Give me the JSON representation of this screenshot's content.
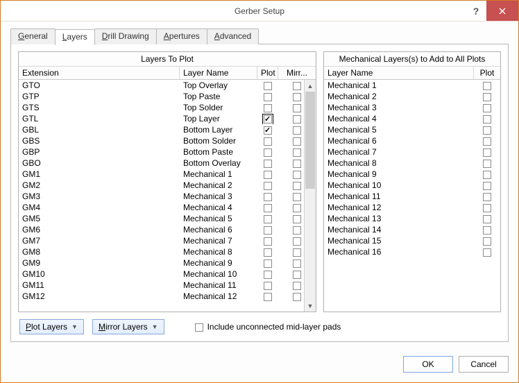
{
  "window": {
    "title": "Gerber Setup"
  },
  "tabs": [
    "General",
    "Layers",
    "Drill Drawing",
    "Apertures",
    "Advanced"
  ],
  "active_tab": 1,
  "left_panel": {
    "title": "Layers To Plot",
    "columns": {
      "ext": "Extension",
      "layer": "Layer Name",
      "plot": "Plot",
      "mirr": "Mirr..."
    },
    "rows": [
      {
        "ext": "GTO",
        "layer": "Top Overlay",
        "plot": false,
        "mirr": false
      },
      {
        "ext": "GTP",
        "layer": "Top Paste",
        "plot": false,
        "mirr": false
      },
      {
        "ext": "GTS",
        "layer": "Top Solder",
        "plot": false,
        "mirr": false
      },
      {
        "ext": "GTL",
        "layer": "Top Layer",
        "plot": true,
        "mirr": false,
        "focused": true
      },
      {
        "ext": "GBL",
        "layer": "Bottom Layer",
        "plot": true,
        "mirr": false
      },
      {
        "ext": "GBS",
        "layer": "Bottom Solder",
        "plot": false,
        "mirr": false
      },
      {
        "ext": "GBP",
        "layer": "Bottom Paste",
        "plot": false,
        "mirr": false
      },
      {
        "ext": "GBO",
        "layer": "Bottom Overlay",
        "plot": false,
        "mirr": false
      },
      {
        "ext": "GM1",
        "layer": "Mechanical 1",
        "plot": false,
        "mirr": false
      },
      {
        "ext": "GM2",
        "layer": "Mechanical 2",
        "plot": false,
        "mirr": false
      },
      {
        "ext": "GM3",
        "layer": "Mechanical 3",
        "plot": false,
        "mirr": false
      },
      {
        "ext": "GM4",
        "layer": "Mechanical 4",
        "plot": false,
        "mirr": false
      },
      {
        "ext": "GM5",
        "layer": "Mechanical 5",
        "plot": false,
        "mirr": false
      },
      {
        "ext": "GM6",
        "layer": "Mechanical 6",
        "plot": false,
        "mirr": false
      },
      {
        "ext": "GM7",
        "layer": "Mechanical 7",
        "plot": false,
        "mirr": false
      },
      {
        "ext": "GM8",
        "layer": "Mechanical 8",
        "plot": false,
        "mirr": false
      },
      {
        "ext": "GM9",
        "layer": "Mechanical 9",
        "plot": false,
        "mirr": false
      },
      {
        "ext": "GM10",
        "layer": "Mechanical 10",
        "plot": false,
        "mirr": false
      },
      {
        "ext": "GM11",
        "layer": "Mechanical 11",
        "plot": false,
        "mirr": false
      },
      {
        "ext": "GM12",
        "layer": "Mechanical 12",
        "plot": false,
        "mirr": false
      }
    ]
  },
  "right_panel": {
    "title": "Mechanical Layers(s) to Add to All Plots",
    "columns": {
      "layer": "Layer Name",
      "plot": "Plot"
    },
    "rows": [
      {
        "layer": "Mechanical 1",
        "plot": false
      },
      {
        "layer": "Mechanical 2",
        "plot": false
      },
      {
        "layer": "Mechanical 3",
        "plot": false
      },
      {
        "layer": "Mechanical 4",
        "plot": false
      },
      {
        "layer": "Mechanical 5",
        "plot": false
      },
      {
        "layer": "Mechanical 6",
        "plot": false
      },
      {
        "layer": "Mechanical 7",
        "plot": false
      },
      {
        "layer": "Mechanical 8",
        "plot": false
      },
      {
        "layer": "Mechanical 9",
        "plot": false
      },
      {
        "layer": "Mechanical 10",
        "plot": false
      },
      {
        "layer": "Mechanical 11",
        "plot": false
      },
      {
        "layer": "Mechanical 12",
        "plot": false
      },
      {
        "layer": "Mechanical 13",
        "plot": false
      },
      {
        "layer": "Mechanical 14",
        "plot": false
      },
      {
        "layer": "Mechanical 15",
        "plot": false
      },
      {
        "layer": "Mechanical 16",
        "plot": false
      }
    ]
  },
  "buttons": {
    "plot_layers": "Plot Layers",
    "mirror_layers": "Mirror Layers",
    "include_unconnected": "Include unconnected mid-layer pads",
    "ok": "OK",
    "cancel": "Cancel"
  },
  "include_unconnected_checked": false
}
